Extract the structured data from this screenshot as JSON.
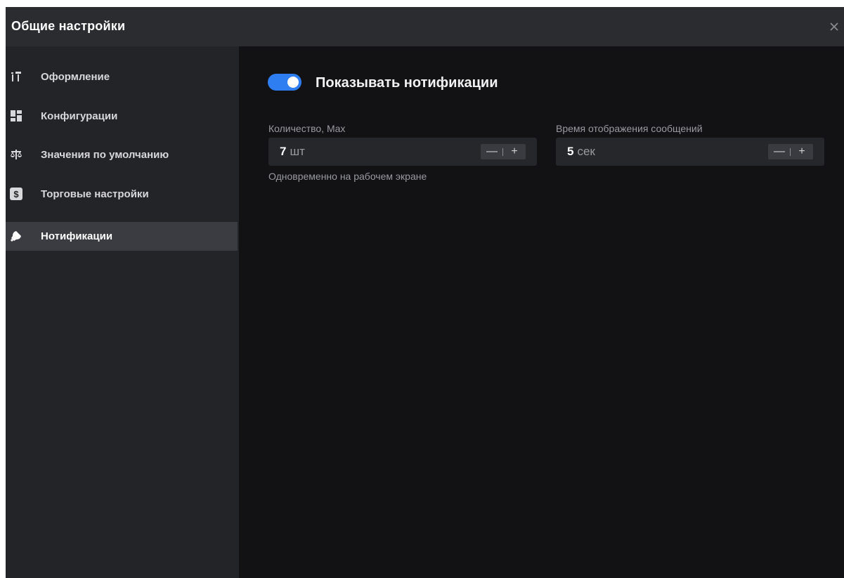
{
  "window": {
    "title": "Общие настройки",
    "close_icon": "close-icon"
  },
  "sidebar": {
    "items": [
      {
        "label": "Оформление",
        "icon": "layout-icon",
        "active": false
      },
      {
        "label": "Конфигурации",
        "icon": "grid-icon",
        "active": false
      },
      {
        "label": "Значения по умолчанию",
        "icon": "scales-icon",
        "active": false
      },
      {
        "label": "Торговые настройки",
        "icon": "dollar-icon",
        "active": false
      },
      {
        "label": "Нотификации",
        "icon": "bell-icon",
        "active": true
      }
    ]
  },
  "notifications": {
    "toggle_label": "Показывать нотификации",
    "toggle_on": true,
    "count": {
      "label": "Количество, Max",
      "value": "7",
      "unit": "шт",
      "hint": "Одновременно на рабочем экране",
      "minus": "—",
      "plus": "+"
    },
    "duration": {
      "label": "Время отображения сообщений",
      "value": "5",
      "unit": "сек",
      "minus": "—",
      "plus": "+"
    }
  },
  "colors": {
    "accent": "#2e7ef2",
    "background": "#121214",
    "sidebar": "#232427",
    "titlebar": "#2b2c30",
    "active_item": "#3b3c41"
  }
}
